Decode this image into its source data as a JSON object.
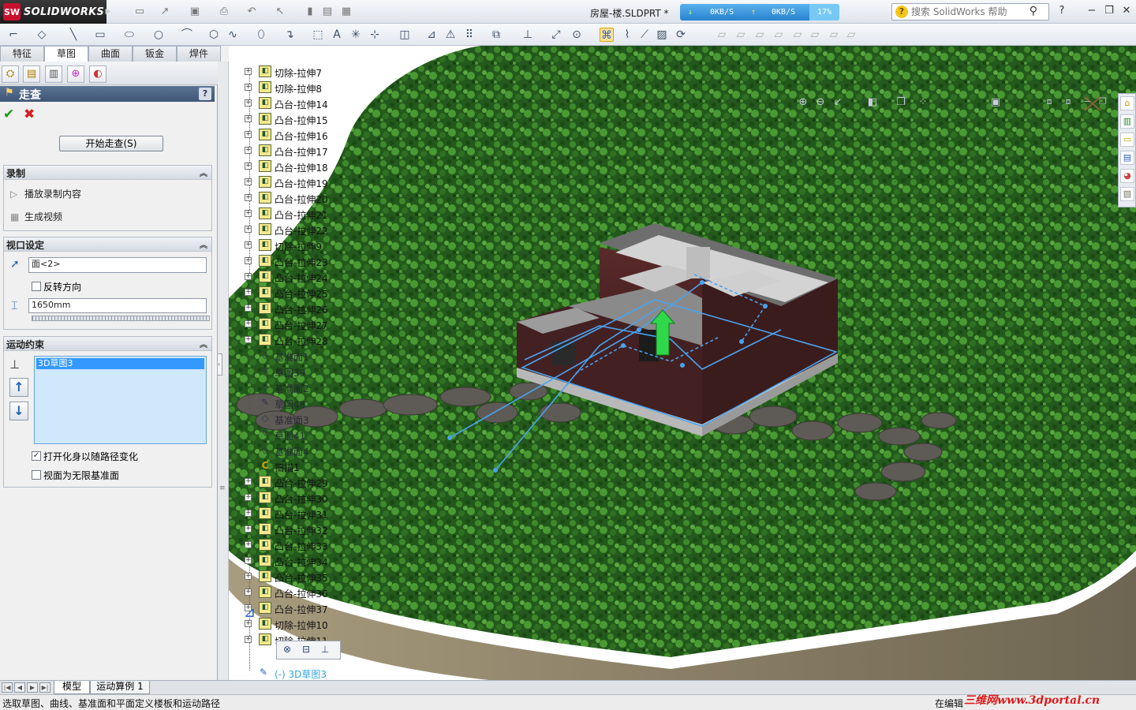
{
  "app": {
    "brand": "SOLIDWORKS",
    "doc_title": "房屋-楼.SLDPRT *"
  },
  "net": {
    "down": "0KB/S",
    "up": "0KB/S",
    "percent": "17%"
  },
  "help_search": {
    "placeholder": "搜索 SolidWorks 帮助"
  },
  "tabs": [
    "特征",
    "草图",
    "曲面",
    "钣金",
    "焊件"
  ],
  "property_manager": {
    "title": "走查",
    "start_button": "开始走查(S)",
    "record": {
      "header": "录制",
      "play": "播放录制内容",
      "generate": "生成视频"
    },
    "viewport": {
      "header": "视口设定",
      "face": "面<2>",
      "reverse": "反转方向",
      "height": "1650mm"
    },
    "motion": {
      "header": "运动约束",
      "selected": "3D草图3",
      "avatar_follow": "打开化身以随路径变化",
      "infinite_plane": "视面为无限基准面"
    }
  },
  "tree": [
    {
      "label": "切除-拉伸7",
      "type": "feature"
    },
    {
      "label": "切除-拉伸8",
      "type": "feature"
    },
    {
      "label": "凸台-拉伸14",
      "type": "feature"
    },
    {
      "label": "凸台-拉伸15",
      "type": "feature"
    },
    {
      "label": "凸台-拉伸16",
      "type": "feature"
    },
    {
      "label": "凸台-拉伸17",
      "type": "feature"
    },
    {
      "label": "凸台-拉伸18",
      "type": "feature"
    },
    {
      "label": "凸台-拉伸19",
      "type": "feature"
    },
    {
      "label": "凸台-拉伸20",
      "type": "feature"
    },
    {
      "label": "凸台-拉伸21",
      "type": "feature"
    },
    {
      "label": "凸台-拉伸22",
      "type": "feature"
    },
    {
      "label": "切除-拉伸9",
      "type": "feature"
    },
    {
      "label": "凸台-拉伸23",
      "type": "feature"
    },
    {
      "label": "凸台-拉伸24",
      "type": "feature"
    },
    {
      "label": "凸台-拉伸25",
      "type": "feature"
    },
    {
      "label": "凸台-拉伸26",
      "type": "feature"
    },
    {
      "label": "凸台-拉伸27",
      "type": "feature"
    },
    {
      "label": "凸台-拉伸28",
      "type": "feature"
    },
    {
      "label": "基准面1",
      "type": "plane"
    },
    {
      "label": "草图39",
      "type": "sketch"
    },
    {
      "label": "基准面2",
      "type": "plane"
    },
    {
      "label": "草图40",
      "type": "sketch"
    },
    {
      "label": "基准面3",
      "type": "plane"
    },
    {
      "label": "草图41",
      "type": "sketch"
    },
    {
      "label": "基准面4",
      "type": "plane"
    },
    {
      "label": "扫描1",
      "type": "sweep"
    },
    {
      "label": "凸台-拉伸29",
      "type": "feature"
    },
    {
      "label": "凸台-拉伸30",
      "type": "feature"
    },
    {
      "label": "凸台-拉伸31",
      "type": "feature"
    },
    {
      "label": "凸台-拉伸32",
      "type": "feature"
    },
    {
      "label": "凸台-拉伸33",
      "type": "feature"
    },
    {
      "label": "凸台-拉伸34",
      "type": "feature"
    },
    {
      "label": "凸台-拉伸35",
      "type": "feature"
    },
    {
      "label": "凸台-拉伸36",
      "type": "feature"
    },
    {
      "label": "凸台-拉伸37",
      "type": "feature"
    },
    {
      "label": "切除-拉伸10",
      "type": "feature"
    },
    {
      "label": "切除-拉伸11",
      "type": "feature"
    }
  ],
  "tree_last": "(-) 3D草图3",
  "bottom_tabs": [
    "模型",
    "运动算例 1"
  ],
  "status": {
    "text": "选取草图、曲线、基准面和平面定义楼板和运动路径",
    "mode": "在编辑",
    "watermark": "三维网www.3dportal.cn"
  }
}
